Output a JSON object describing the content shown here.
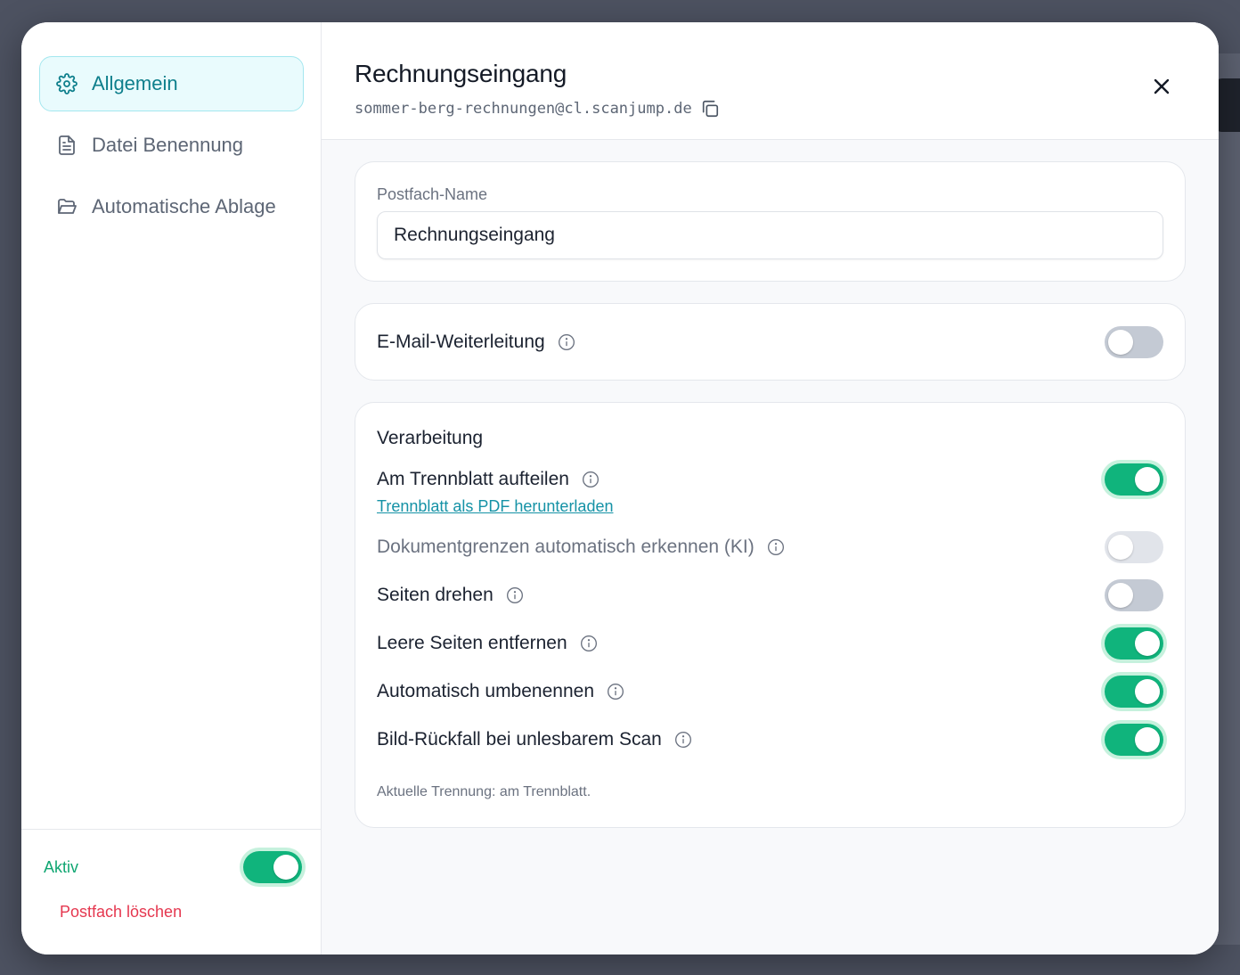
{
  "sidebar": {
    "items": [
      {
        "label": "Allgemein",
        "icon": "gear-icon",
        "active": true
      },
      {
        "label": "Datei Benennung",
        "icon": "document-icon",
        "active": false
      },
      {
        "label": "Automatische Ablage",
        "icon": "folder-open-icon",
        "active": false
      }
    ],
    "footer": {
      "active_label": "Aktiv",
      "active_on": true,
      "delete_label": "Postfach löschen"
    }
  },
  "header": {
    "title": "Rechnungseingang",
    "email": "sommer-berg-rechnungen@cl.scanjump.de"
  },
  "name_card": {
    "label": "Postfach-Name",
    "value": "Rechnungseingang"
  },
  "forwarding": {
    "label": "E-Mail-Weiterleitung",
    "on": false
  },
  "processing": {
    "title": "Verarbeitung",
    "split": {
      "label": "Am Trennblatt aufteilen",
      "on": true
    },
    "pdf_link": "Trennblatt als PDF herunterladen",
    "detect": {
      "label": "Dokumentgrenzen automatisch erkennen (KI)",
      "on": false,
      "disabled": true
    },
    "rotate": {
      "label": "Seiten drehen",
      "on": false
    },
    "blank": {
      "label": "Leere Seiten entfernen",
      "on": true
    },
    "rename": {
      "label": "Automatisch umbenennen",
      "on": true
    },
    "fallback": {
      "label": "Bild-Rückfall bei unlesbarem Scan",
      "on": true
    },
    "hint": "Aktuelle Trennung: am Trennblatt."
  },
  "colors": {
    "accent_teal": "#0e7f8c",
    "toggle_on": "#10b47c",
    "danger": "#e5374f",
    "link": "#1592a6"
  }
}
